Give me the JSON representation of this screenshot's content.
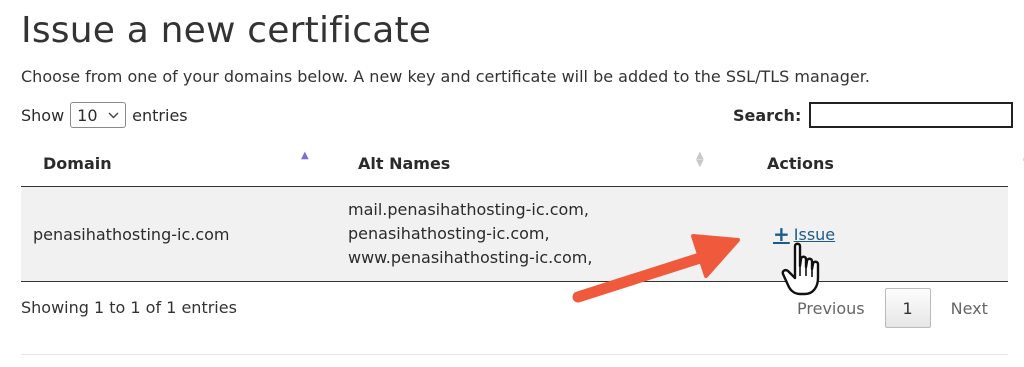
{
  "title": "Issue a new certificate",
  "description": "Choose from one of your domains below. A new key and certificate will be added to the SSL/TLS manager.",
  "controls": {
    "show_label": "Show",
    "entries_value": "10",
    "entries_label": "entries",
    "search_label": "Search:",
    "search_value": ""
  },
  "table": {
    "headers": [
      "Domain",
      "Alt Names",
      "Actions"
    ],
    "rows": [
      {
        "domain": "penasihathosting-ic.com",
        "alt_names": [
          "mail.penasihathosting-ic.com,",
          "penasihathosting-ic.com,",
          "www.penasihathosting-ic.com,"
        ],
        "action_label": "Issue"
      }
    ]
  },
  "footer": {
    "showing": "Showing 1 to 1 of 1 entries",
    "previous": "Previous",
    "current_page": "1",
    "next": "Next"
  },
  "colors": {
    "link": "#1e5a8c",
    "sort_active": "#7b6fd6",
    "annotation_arrow": "#f05a3c",
    "row_background": "#f1f1f1"
  },
  "icons": {
    "issue": "plus-icon",
    "sort": "sort-arrows-icon",
    "select": "chevron-down-icon",
    "cursor": "hand-pointer-icon",
    "annotation": "red-arrow-icon"
  }
}
